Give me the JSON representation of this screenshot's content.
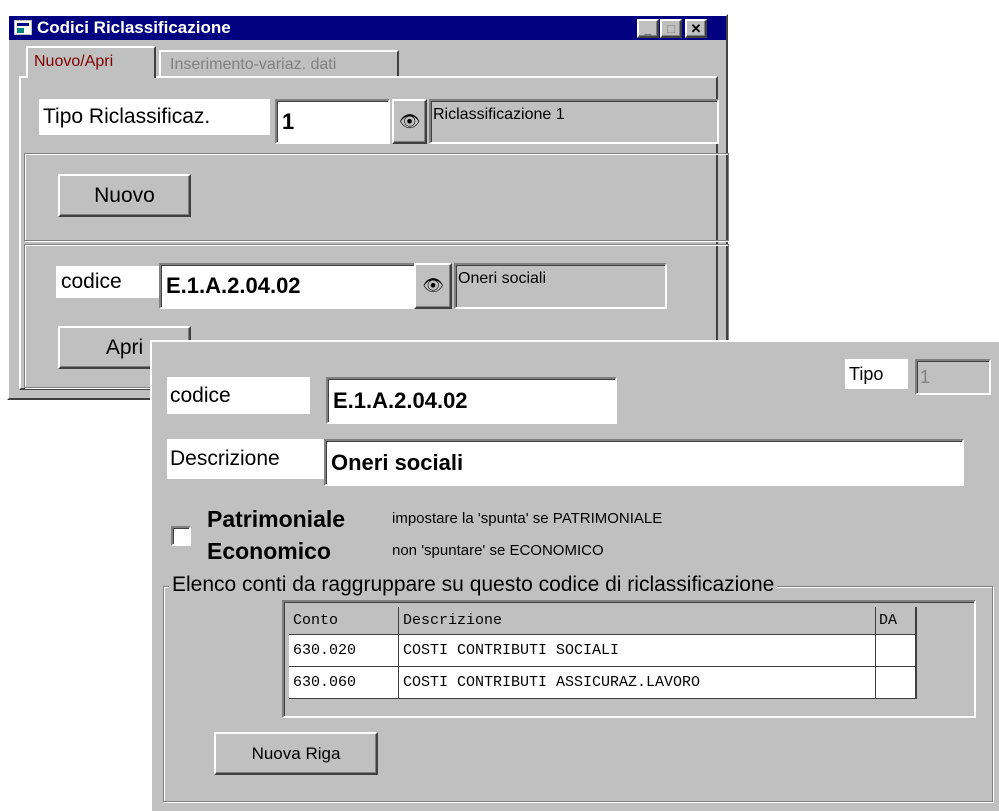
{
  "window1": {
    "title": "Codici Riclassificazione",
    "tabs": [
      {
        "label": "Nuovo/Apri",
        "active": true
      },
      {
        "label": "Inserimento-variaz. dati",
        "active": false
      }
    ],
    "tipo_label": "Tipo Riclassificaz.",
    "tipo_value": "1",
    "tipo_desc": "Riclassificazione 1",
    "nuovo_button": "Nuovo",
    "codice_label": "codice",
    "codice_value": "E.1.A.2.04.02",
    "codice_desc": "Oneri sociali",
    "apri_button": "Apri",
    "controls": {
      "minimize": "_",
      "maximize": "□",
      "close": "✕"
    }
  },
  "window2": {
    "tipo_label": "Tipo",
    "tipo_value": "1",
    "codice_label": "codice",
    "codice_value": "E.1.A.2.04.02",
    "descrizione_label": "Descrizione",
    "descrizione_value": "Oneri sociali",
    "patrimoniale_label": "Patrimoniale",
    "economico_label": "Economico",
    "patrimoniale_hint": "impostare la 'spunta' se PATRIMONIALE",
    "economico_hint": "non 'spuntare' se ECONOMICO",
    "checkbox_checked": false,
    "group_title": "Elenco conti da raggruppare su questo codice di riclassificazione",
    "table": {
      "headers": [
        "Conto",
        "Descrizione",
        "DA"
      ],
      "rows": [
        [
          "630.020",
          "COSTI CONTRIBUTI SOCIALI",
          ""
        ],
        [
          "630.060",
          "COSTI CONTRIBUTI ASSICURAZ.LAVORO",
          ""
        ]
      ]
    },
    "nuova_riga_button": "Nuova Riga"
  },
  "icons": {
    "app_icon": "app-window-icon",
    "search": "binoculars-icon"
  },
  "colors": {
    "titlebar": "#000080",
    "face": "#c0c0c0",
    "active_tab_text": "#800000",
    "disabled_text": "#808080"
  }
}
